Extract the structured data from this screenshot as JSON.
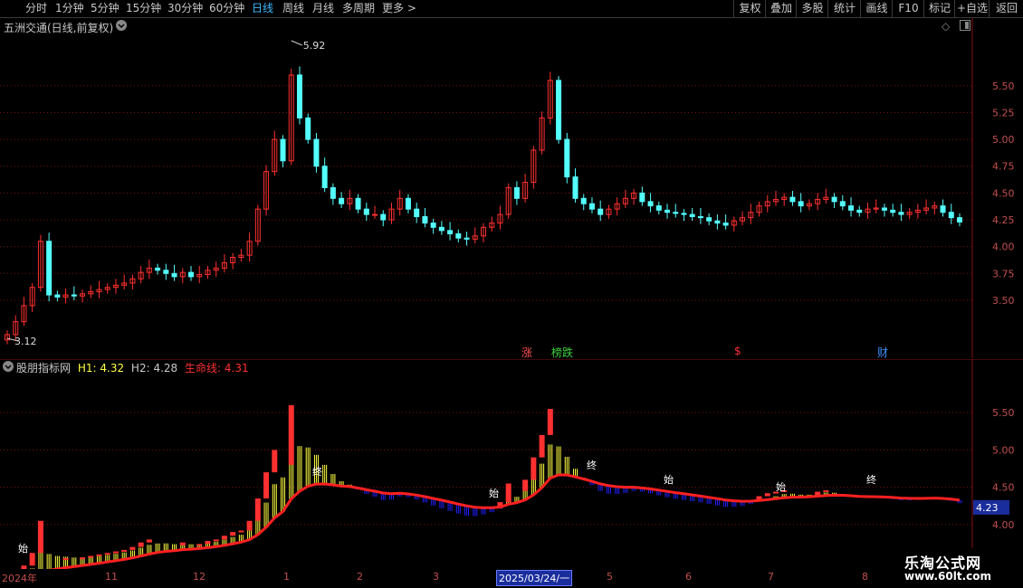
{
  "toolbar": {
    "periods": [
      "分时",
      "1分钟",
      "5分钟",
      "15分钟",
      "30分钟",
      "60分钟",
      "日线",
      "周线",
      "月线",
      "多周期",
      "更多 >"
    ],
    "active_period": "日线",
    "actions": [
      "复权",
      "叠加",
      "多股",
      "统计",
      "画线",
      "F10",
      "标记",
      "+自选",
      "返回"
    ]
  },
  "main": {
    "title": "五洲交通(日线,前复权)",
    "price_ticks": [
      "5.50",
      "5.25",
      "5.00",
      "4.75",
      "4.50",
      "4.25",
      "4.00",
      "3.75",
      "3.50"
    ],
    "high_label": "5.92",
    "low_label": "3.12",
    "events": [
      {
        "text": "涨",
        "color": "#ff5050"
      },
      {
        "text": "榜跌",
        "color": "#40d040"
      },
      {
        "text": "$",
        "color": "#ff3030"
      },
      {
        "text": "财",
        "color": "#4090ff"
      }
    ]
  },
  "indicator": {
    "name": "股朋指标网",
    "h1_label": "H1:",
    "h1_value": "4.32",
    "h2_label": "H2:",
    "h2_value": "4.28",
    "life_label": "生命线:",
    "life_value": "4.31",
    "ticks": [
      "5.50",
      "5.00",
      "4.50",
      "4.00"
    ],
    "current_value": "4.23",
    "markers": [
      {
        "text": "始"
      },
      {
        "text": "终"
      },
      {
        "text": "始"
      },
      {
        "text": "终"
      },
      {
        "text": "始"
      },
      {
        "text": "始"
      },
      {
        "text": "终"
      }
    ]
  },
  "date_axis": {
    "labels": [
      "2024年",
      "11",
      "12",
      "1",
      "2",
      "3",
      "2025/03/24/一",
      "5",
      "6",
      "7",
      "8"
    ],
    "selected": "2025/03/24/一"
  },
  "watermark": {
    "line1": "乐淘公式网",
    "line2": "www.60lt.com"
  },
  "colors": {
    "up": "#ff3030",
    "down": "#54ffff",
    "life": "#ff2020",
    "yellow": "#ffff40",
    "blue": "#2020ff",
    "grid": "#7a1010"
  },
  "chart_data": {
    "type": "candlestick",
    "title": "五洲交通(日线,前复权)",
    "ylim": [
      3.12,
      5.92
    ],
    "closes": [
      3.18,
      3.3,
      3.45,
      3.62,
      4.05,
      3.55,
      3.53,
      3.55,
      3.54,
      3.56,
      3.58,
      3.6,
      3.62,
      3.64,
      3.66,
      3.7,
      3.76,
      3.8,
      3.78,
      3.75,
      3.72,
      3.76,
      3.72,
      3.74,
      3.78,
      3.8,
      3.85,
      3.9,
      3.92,
      4.05,
      4.35,
      4.7,
      5.0,
      4.8,
      5.6,
      5.2,
      5.0,
      4.75,
      4.55,
      4.45,
      4.4,
      4.45,
      4.35,
      4.3,
      4.3,
      4.25,
      4.35,
      4.45,
      4.35,
      4.28,
      4.22,
      4.18,
      4.15,
      4.12,
      4.08,
      4.07,
      4.1,
      4.18,
      4.22,
      4.3,
      4.55,
      4.45,
      4.6,
      4.9,
      5.2,
      5.55,
      5.0,
      4.65,
      4.45,
      4.4,
      4.35,
      4.3,
      4.35,
      4.4,
      4.45,
      4.5,
      4.42,
      4.38,
      4.34,
      4.32,
      4.31,
      4.3,
      4.28,
      4.27,
      4.24,
      4.22,
      4.2,
      4.24,
      4.27,
      4.32,
      4.38,
      4.42,
      4.44,
      4.46,
      4.42,
      4.38,
      4.4,
      4.44,
      4.46,
      4.42,
      4.38,
      4.34,
      4.32,
      4.35,
      4.36,
      4.34,
      4.32,
      4.3,
      4.32,
      4.34,
      4.36,
      4.38,
      4.32,
      4.27,
      4.23
    ],
    "h1": 4.32,
    "h2": 4.28,
    "life_line": 4.31
  }
}
